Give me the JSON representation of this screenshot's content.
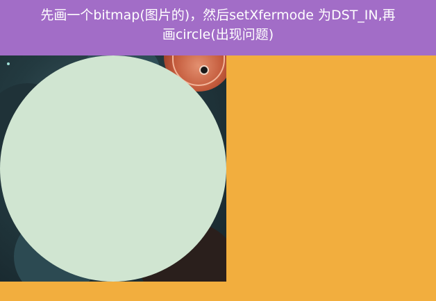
{
  "title": {
    "line1": "先画一个bitmap(图片的)，然后setXfermode 为DST_IN,再",
    "line2": "画circle(出现问题)"
  },
  "colors": {
    "title_bar_bg": "#a26dc7",
    "page_bg": "#f2ae3e",
    "circle_fill": "#d0e5d1"
  }
}
